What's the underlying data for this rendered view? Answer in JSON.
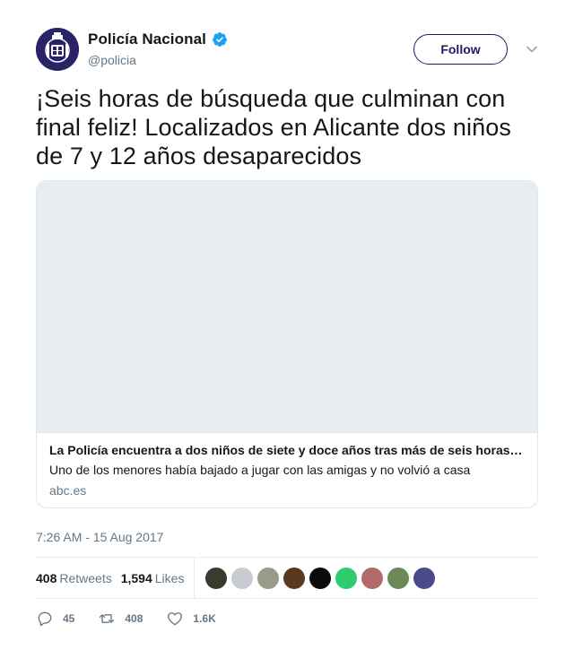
{
  "author": {
    "display_name": "Policía Nacional",
    "handle": "@policia",
    "verified": true,
    "avatar_icon": "police-badge-logo",
    "avatar_color": "#2a2466"
  },
  "follow_label": "Follow",
  "tweet_text": "¡Seis horas de búsqueda que culminan con final feliz! Localizados en Alicante dos niños de 7 y 12 años desaparecidos",
  "card": {
    "title": "La Policía encuentra a dos niños de siete y doce años tras más de seis horas de búsqueda",
    "description": "Uno de los menores había bajado a jugar con las amigas y no volvió a casa",
    "domain": "abc.es"
  },
  "timestamp": "7:26 AM - 15 Aug 2017",
  "stats": {
    "retweets_count": "408",
    "retweets_label": "Retweets",
    "likes_count": "1,594",
    "likes_label": "Likes"
  },
  "liker_avatar_colors": [
    "#3a3a2e",
    "#c8ccd0",
    "#9a9a8a",
    "#5a3a1e",
    "#0a0a0a",
    "#2ecc71",
    "#b06a6a",
    "#6a8a5a",
    "#4a4a8a"
  ],
  "actions": {
    "reply_count": "45",
    "retweet_count": "408",
    "like_count": "1.6K"
  },
  "colors": {
    "accent": "#1d1a5e",
    "verified": "#1da1f2",
    "muted": "#657786"
  }
}
